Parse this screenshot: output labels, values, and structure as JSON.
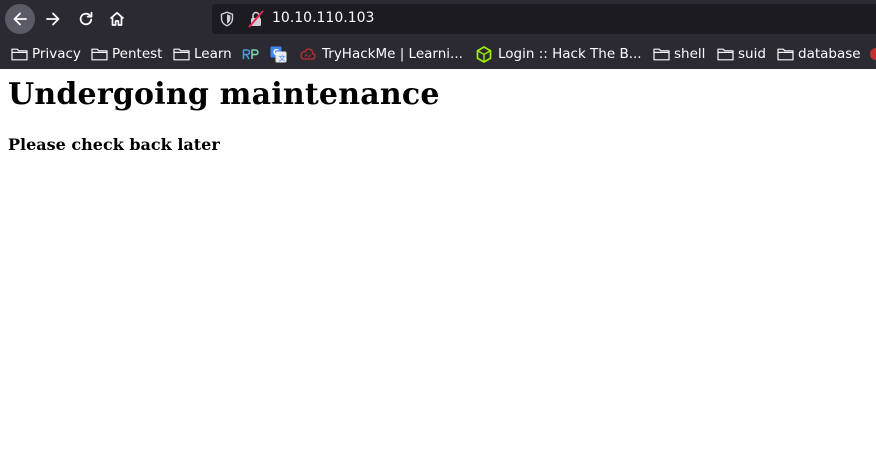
{
  "browser": {
    "url": "10.10.110.103",
    "bookmarks": [
      {
        "label": "Privacy",
        "icon": "folder-icon"
      },
      {
        "label": "Pentest",
        "icon": "folder-icon"
      },
      {
        "label": "Learn",
        "icon": "folder-icon"
      },
      {
        "label": "",
        "icon": "rp-icon"
      },
      {
        "label": "",
        "icon": "translate-icon"
      },
      {
        "label": "TryHackMe | Learni...",
        "icon": "tryhackme-icon"
      },
      {
        "label": "Login :: Hack The B...",
        "icon": "hackthebox-icon"
      },
      {
        "label": "shell",
        "icon": "folder-icon"
      },
      {
        "label": "suid",
        "icon": "folder-icon"
      },
      {
        "label": "database",
        "icon": "folder-icon"
      }
    ]
  },
  "page": {
    "heading": "Undergoing maintenance",
    "subheading": "Please check back later"
  },
  "colors": {
    "chrome_bg": "#2b2a33",
    "urlbar_bg": "#1c1b22",
    "text_light": "#fbfbfe",
    "page_bg": "#ffffff"
  }
}
